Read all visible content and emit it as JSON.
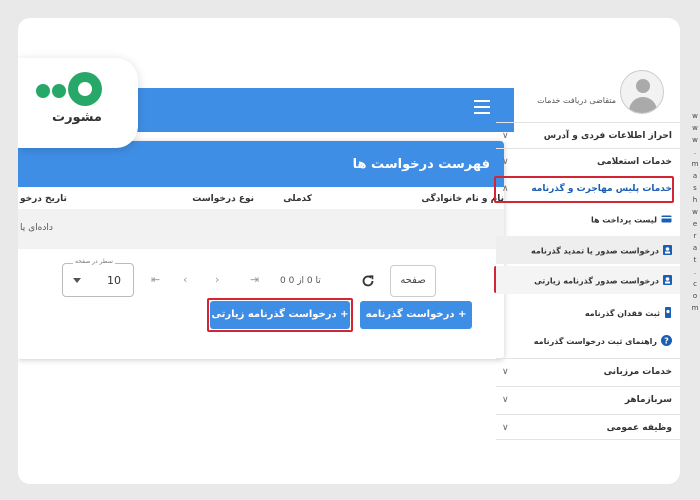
{
  "logo": {
    "text": "مشورت"
  },
  "watermark": "www.mashwerat.com",
  "card": {
    "title": "فهرست درخواست ها",
    "columns": [
      "نام و نام خانوادگی",
      "کدملی",
      "نوع درخواست",
      "تاریخ درخو"
    ],
    "no_data": "داده‌ای یا",
    "page_label": "صفحه",
    "range_text": "0 تا 0 از 0",
    "rows_per_page_caption": "سطر در صفحه",
    "rows_per_page_value": "10"
  },
  "buttons": {
    "passport_request": "درخواست گذرنامه",
    "pilgrimage_passport_request": "درخواست گذرنامه زیارتی"
  },
  "sidebar": {
    "profile_name": "متقاضی دریافت خدمات",
    "menu": [
      "احراز اطلاعات فردی و آدرس",
      "خدمات استعلامی",
      "خدمات پلیس مهاجرت و گذرنامه"
    ],
    "sub_items": [
      "لیست پرداخت ها",
      "درخواست صدور یا تمدید گذرنامه",
      "درخواست صدور گذرنامه زیارتی",
      "ثبت فقدان گذرنامه",
      "راهنمای ثبت درخواست گذرنامه"
    ],
    "menu2": [
      "خدمات مرزبانی",
      "سربازماهر",
      "وظیفه عمومی"
    ]
  },
  "colors": {
    "primary": "#3f8ee6",
    "highlight": "#d32533",
    "logo": "#28a868"
  },
  "icons": [
    "hamburger-icon",
    "refresh-icon",
    "plus-icon",
    "card-icon",
    "badge-icon",
    "passport-icon",
    "help-icon",
    "chevron-down-icon",
    "avatar-icon"
  ]
}
